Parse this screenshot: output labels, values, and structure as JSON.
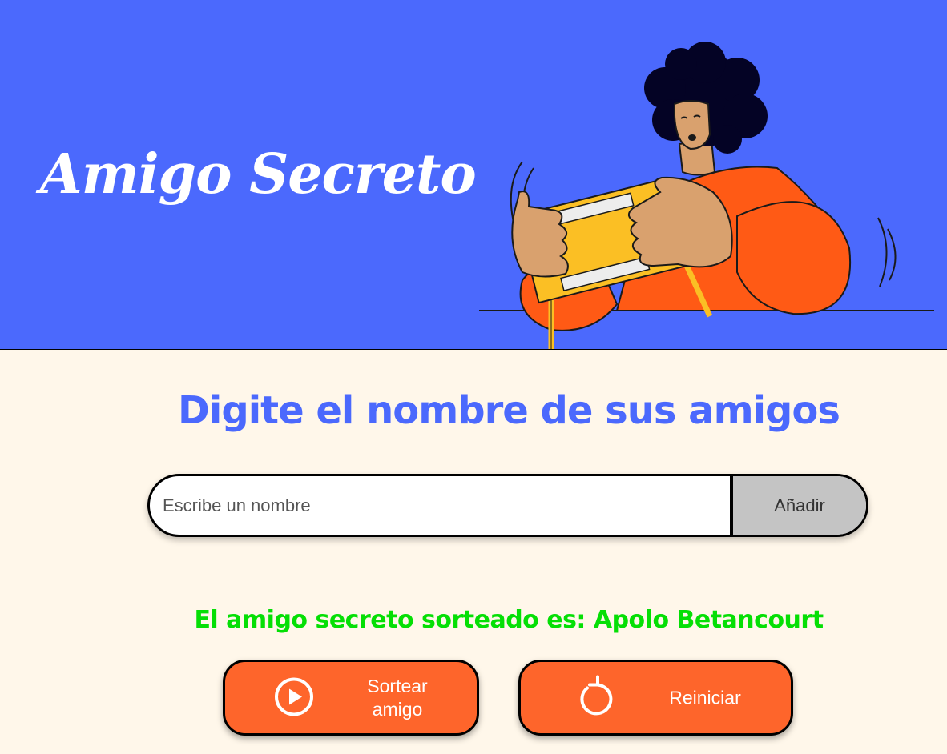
{
  "header": {
    "title": "Amigo Secreto",
    "background_color": "#4B69FD"
  },
  "main": {
    "heading": "Digite el nombre de sus amigos",
    "input": {
      "placeholder": "Escribe un nombre",
      "value": ""
    },
    "add_button_label": "Añadir",
    "result_text": "El amigo secreto sorteado es: Apolo Betancourt",
    "result_color": "#05DF05",
    "draw_button": {
      "label_line1": "Sortear",
      "label_line2": "amigo",
      "icon": "play-circle-icon"
    },
    "reset_button": {
      "label": "Reiniciar",
      "icon": "restart-icon"
    },
    "accent_color": "#FE652B"
  }
}
